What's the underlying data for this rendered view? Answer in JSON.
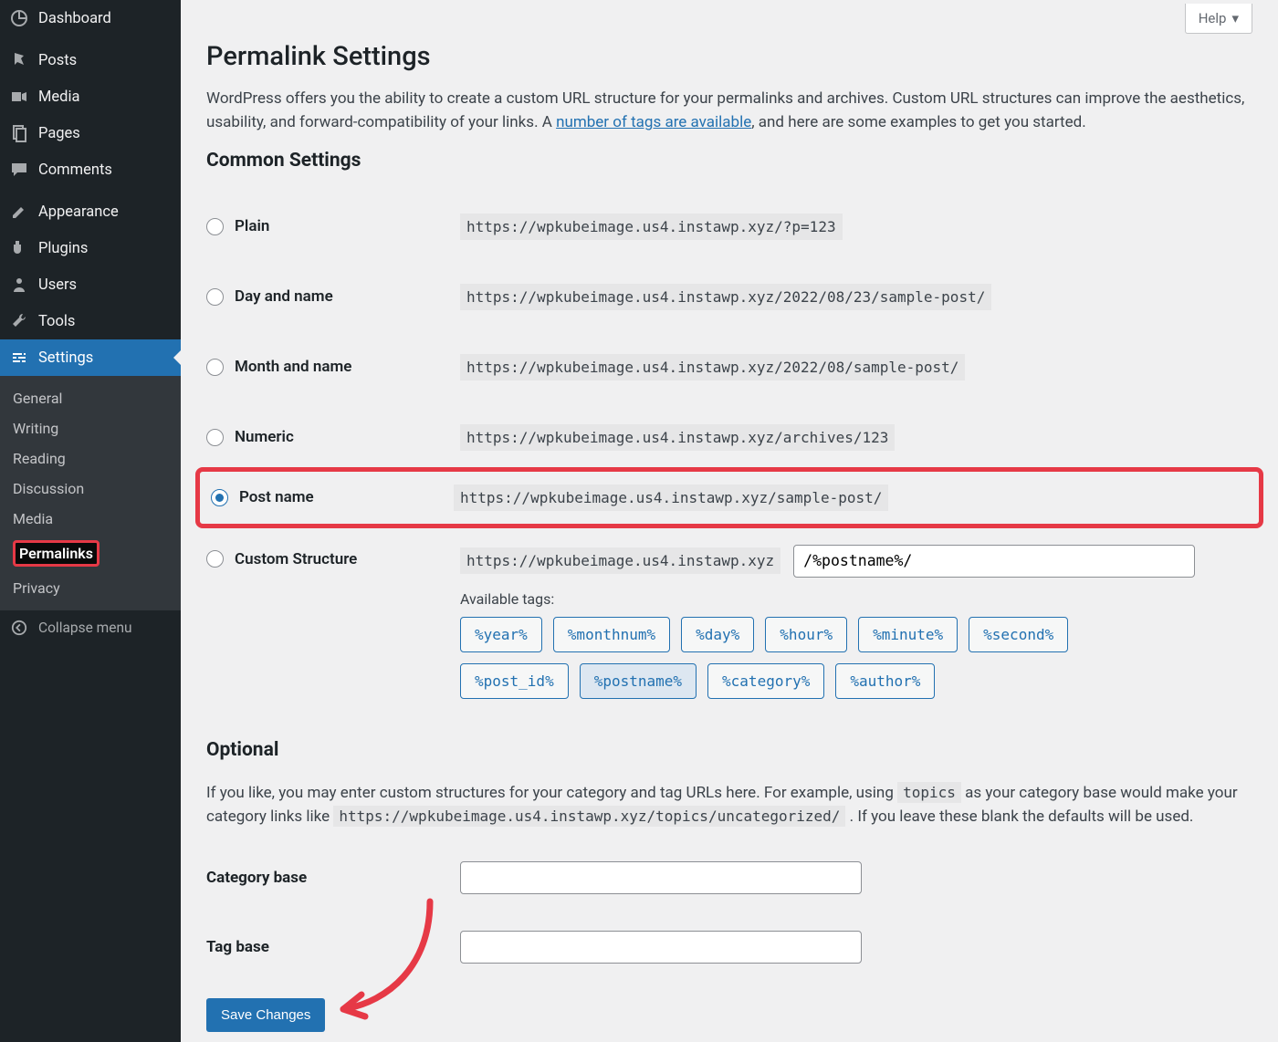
{
  "sidebar": {
    "items": [
      {
        "label": "Dashboard",
        "icon": "dashboard-icon"
      },
      {
        "label": "Posts",
        "icon": "pin-icon"
      },
      {
        "label": "Media",
        "icon": "media-icon"
      },
      {
        "label": "Pages",
        "icon": "pages-icon"
      },
      {
        "label": "Comments",
        "icon": "comment-icon"
      },
      {
        "label": "Appearance",
        "icon": "brush-icon"
      },
      {
        "label": "Plugins",
        "icon": "plug-icon"
      },
      {
        "label": "Users",
        "icon": "users-icon"
      },
      {
        "label": "Tools",
        "icon": "wrench-icon"
      },
      {
        "label": "Settings",
        "icon": "sliders-icon"
      }
    ],
    "submenu": [
      "General",
      "Writing",
      "Reading",
      "Discussion",
      "Media",
      "Permalinks",
      "Privacy"
    ],
    "collapse_label": "Collapse menu"
  },
  "help_tab": "Help",
  "page_title": "Permalink Settings",
  "intro_before_link": "WordPress offers you the ability to create a custom URL structure for your permalinks and archives. Custom URL structures can improve the aesthetics, usability, and forward-compatibility of your links. A ",
  "intro_link_text": "number of tags are available",
  "intro_after_link": ", and here are some examples to get you started.",
  "common_heading": "Common Settings",
  "options": [
    {
      "key": "plain",
      "label": "Plain",
      "example": "https://wpkubeimage.us4.instawp.xyz/?p=123",
      "checked": false
    },
    {
      "key": "dayname",
      "label": "Day and name",
      "example": "https://wpkubeimage.us4.instawp.xyz/2022/08/23/sample-post/",
      "checked": false
    },
    {
      "key": "monthname",
      "label": "Month and name",
      "example": "https://wpkubeimage.us4.instawp.xyz/2022/08/sample-post/",
      "checked": false
    },
    {
      "key": "numeric",
      "label": "Numeric",
      "example": "https://wpkubeimage.us4.instawp.xyz/archives/123",
      "checked": false
    },
    {
      "key": "postname",
      "label": "Post name",
      "example": "https://wpkubeimage.us4.instawp.xyz/sample-post/",
      "checked": true
    }
  ],
  "custom": {
    "label": "Custom Structure",
    "base_url": "https://wpkubeimage.us4.instawp.xyz",
    "value": "/%postname%/",
    "available_label": "Available tags:",
    "tags": [
      "%year%",
      "%monthnum%",
      "%day%",
      "%hour%",
      "%minute%",
      "%second%",
      "%post_id%",
      "%postname%",
      "%category%",
      "%author%"
    ],
    "active_tag": "%postname%"
  },
  "optional_heading": "Optional",
  "optional_text_1": "If you like, you may enter custom structures for your category and tag URLs here. For example, using ",
  "optional_code_1": "topics",
  "optional_text_2": " as your category base would make your category links like ",
  "optional_code_2": "https://wpkubeimage.us4.instawp.xyz/topics/uncategorized/",
  "optional_text_3": " . If you leave these blank the defaults will be used.",
  "optional_fields": {
    "category_label": "Category base",
    "category_value": "",
    "tag_label": "Tag base",
    "tag_value": ""
  },
  "save_label": "Save Changes"
}
